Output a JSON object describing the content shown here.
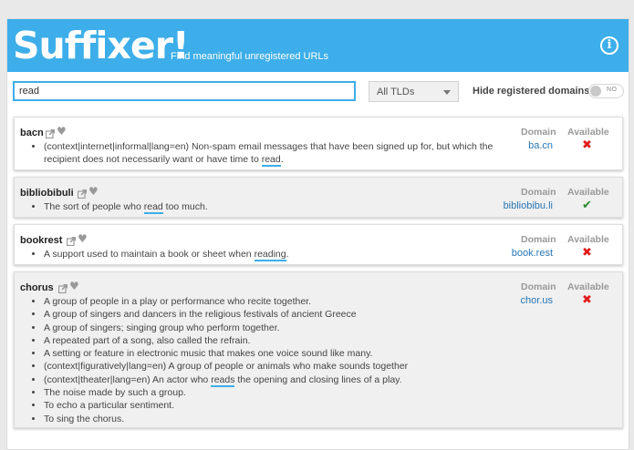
{
  "header": {
    "logo": "Suffixer!",
    "tagline": "Find meaningful unregistered URLs",
    "info_icon": "ⓘ",
    "bg_color": "#3daee9"
  },
  "search": {
    "value": "read",
    "tld_selected": "All TLDs",
    "hide_label": "Hide registered domains?",
    "toggle_state": "NO"
  },
  "columns": {
    "domain": "Domain",
    "available": "Available"
  },
  "results": [
    {
      "word": "bacn",
      "definitions": [
        [
          "(context|internet|informal|lang=en) Non-spam email messages that have been signed up for, but which the recipient does not necessarily want or have time to ",
          "read",
          "."
        ]
      ],
      "domain": "ba.cn",
      "available": false,
      "status_glyph": "✖"
    },
    {
      "word": "bibliobibuli",
      "definitions": [
        [
          "The sort of people who ",
          "read",
          " too much."
        ]
      ],
      "domain": "bibliobibu.li",
      "available": true,
      "status_glyph": "✔"
    },
    {
      "word": "bookrest",
      "definitions": [
        [
          "A support used to maintain a book or sheet when ",
          "reading",
          "."
        ]
      ],
      "domain": "book.rest",
      "available": false,
      "status_glyph": "✖"
    },
    {
      "word": "chorus",
      "definitions": [
        [
          "A group of people in a play or performance who recite together."
        ],
        [
          "A group of singers and dancers in the religious festivals of ancient Greece"
        ],
        [
          "A group of singers; singing group who perform together."
        ],
        [
          "A repeated part of a song, also called the refrain."
        ],
        [
          "A setting or feature in electronic music that makes one voice sound like many."
        ],
        [
          "(context|figuratively|lang=en) A group of people or animals who make sounds together"
        ],
        [
          "(context|theater|lang=en) An actor who ",
          "reads",
          " the opening and closing lines of a play."
        ],
        [
          "The noise made by such a group."
        ],
        [
          "To echo a particular sentiment."
        ],
        [
          "To sing the chorus."
        ]
      ],
      "domain": "chor.us",
      "available": false,
      "status_glyph": "✖"
    }
  ]
}
